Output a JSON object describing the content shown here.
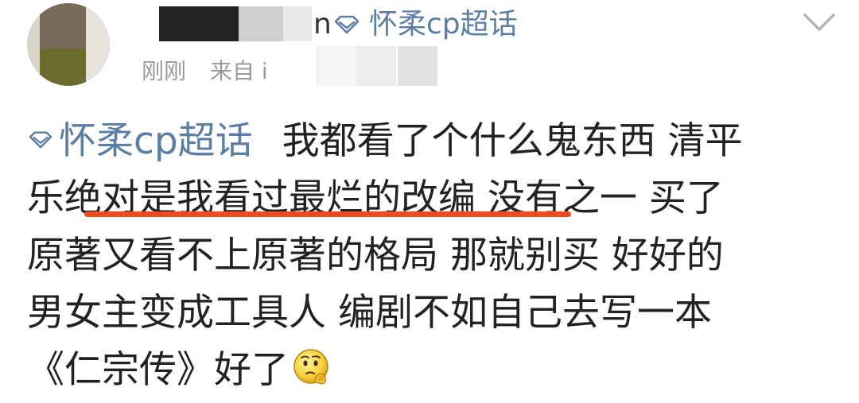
{
  "header": {
    "username_visible_tail": "n",
    "topic_label": "怀柔cp超话",
    "menu_icon": "chevron-down-icon"
  },
  "meta": {
    "time": "刚刚",
    "source_prefix": "来自 i"
  },
  "post": {
    "topic_tag": "怀柔cp超话",
    "lines": [
      "我都看了个什么鬼东西 清平",
      "乐绝对是我看过最烂的改编 没有之一 买了",
      "原著又看不上原著的格局 那就别买 好好的",
      "男女主变成工具人 编剧不如自己去写一本",
      "《仁宗传》好了"
    ],
    "emoji": "thinking-face-emoji"
  },
  "colors": {
    "link": "#5b7ea3",
    "text": "#222222",
    "meta": "#9a9a9a",
    "highlight_underline": "#ee4c1f"
  }
}
